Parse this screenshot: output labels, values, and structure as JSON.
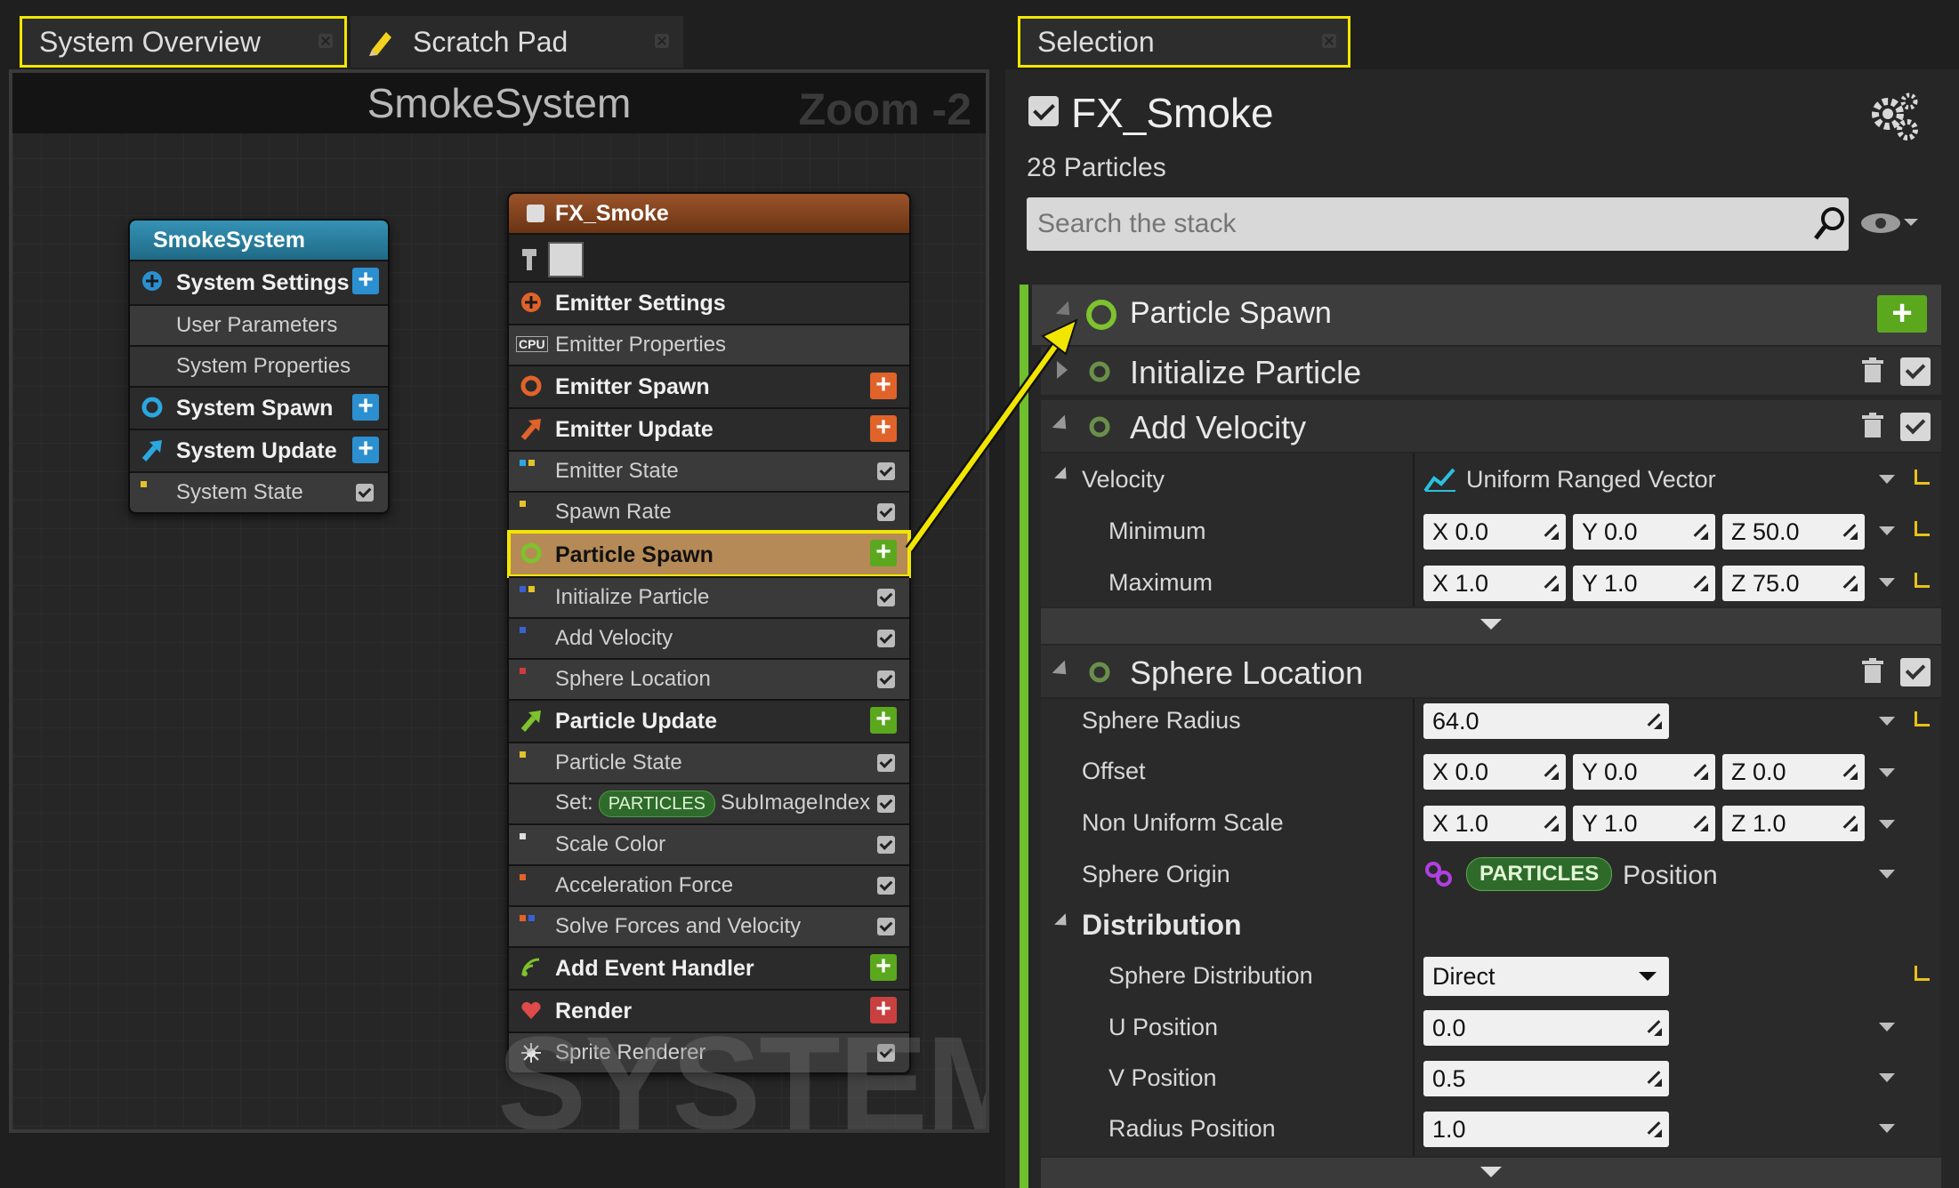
{
  "tabs": {
    "system_overview": "System Overview",
    "scratch_pad": "Scratch Pad",
    "selection": "Selection"
  },
  "graph": {
    "title": "SmokeSystem",
    "zoom": "Zoom -2",
    "watermark": "SYSTEM",
    "system_node": {
      "title": "SmokeSystem",
      "rows": {
        "system_settings": "System Settings",
        "user_parameters": "User Parameters",
        "system_properties": "System Properties",
        "system_spawn": "System Spawn",
        "system_update": "System Update",
        "system_state": "System State"
      }
    },
    "emitter_node": {
      "title": "FX_Smoke",
      "rows": {
        "emitter_settings": "Emitter Settings",
        "emitter_properties": "Emitter Properties",
        "cpu_badge": "CPU",
        "emitter_spawn": "Emitter Spawn",
        "emitter_update": "Emitter Update",
        "emitter_state": "Emitter State",
        "spawn_rate": "Spawn Rate",
        "particle_spawn": "Particle Spawn",
        "initialize_particle": "Initialize Particle",
        "add_velocity": "Add Velocity",
        "sphere_location": "Sphere Location",
        "particle_update": "Particle Update",
        "particle_state": "Particle State",
        "set_prefix": "Set:",
        "set_pill": "PARTICLES",
        "set_target": "SubImageIndex",
        "scale_color": "Scale Color",
        "acceleration_force": "Acceleration Force",
        "solve_forces": "Solve Forces and Velocity",
        "add_event_handler": "Add Event Handler",
        "render": "Render",
        "sprite_renderer": "Sprite Renderer"
      }
    }
  },
  "panel": {
    "emitter_name": "FX_Smoke",
    "particle_count": "28 Particles",
    "search_placeholder": "Search the stack",
    "groups": {
      "particle_spawn": "Particle Spawn",
      "initialize_particle": "Initialize Particle",
      "add_velocity": "Add Velocity",
      "sphere_location": "Sphere Location"
    },
    "velocity": {
      "label": "Velocity",
      "mode": "Uniform Ranged Vector",
      "minimum_label": "Minimum",
      "maximum_label": "Maximum",
      "min": {
        "x": "X 0.0",
        "y": "Y 0.0",
        "z": "Z 50.0"
      },
      "max": {
        "x": "X 1.0",
        "y": "Y 1.0",
        "z": "Z 75.0"
      }
    },
    "sphere": {
      "radius_label": "Sphere Radius",
      "radius_value": "64.0",
      "offset_label": "Offset",
      "offset": {
        "x": "X 0.0",
        "y": "Y 0.0",
        "z": "Z 0.0"
      },
      "scale_label": "Non Uniform Scale",
      "scale": {
        "x": "X 1.0",
        "y": "Y 1.0",
        "z": "Z 1.0"
      },
      "origin_label": "Sphere Origin",
      "origin_pill": "PARTICLES",
      "origin_value": "Position",
      "distribution_label": "Distribution",
      "sphere_distribution_label": "Sphere Distribution",
      "sphere_distribution_value": "Direct",
      "u_label": "U Position",
      "u_value": "0.0",
      "v_label": "V Position",
      "v_value": "0.5",
      "r_label": "Radius Position",
      "r_value": "1.0"
    }
  },
  "colors": {
    "highlight": "#f2e600",
    "accent_green": "#6fbf2e",
    "accent_orange": "#e0632a",
    "accent_blue": "#2ba7e0",
    "system_header": "#2b7f9e",
    "emitter_header": "#8a4a22"
  }
}
